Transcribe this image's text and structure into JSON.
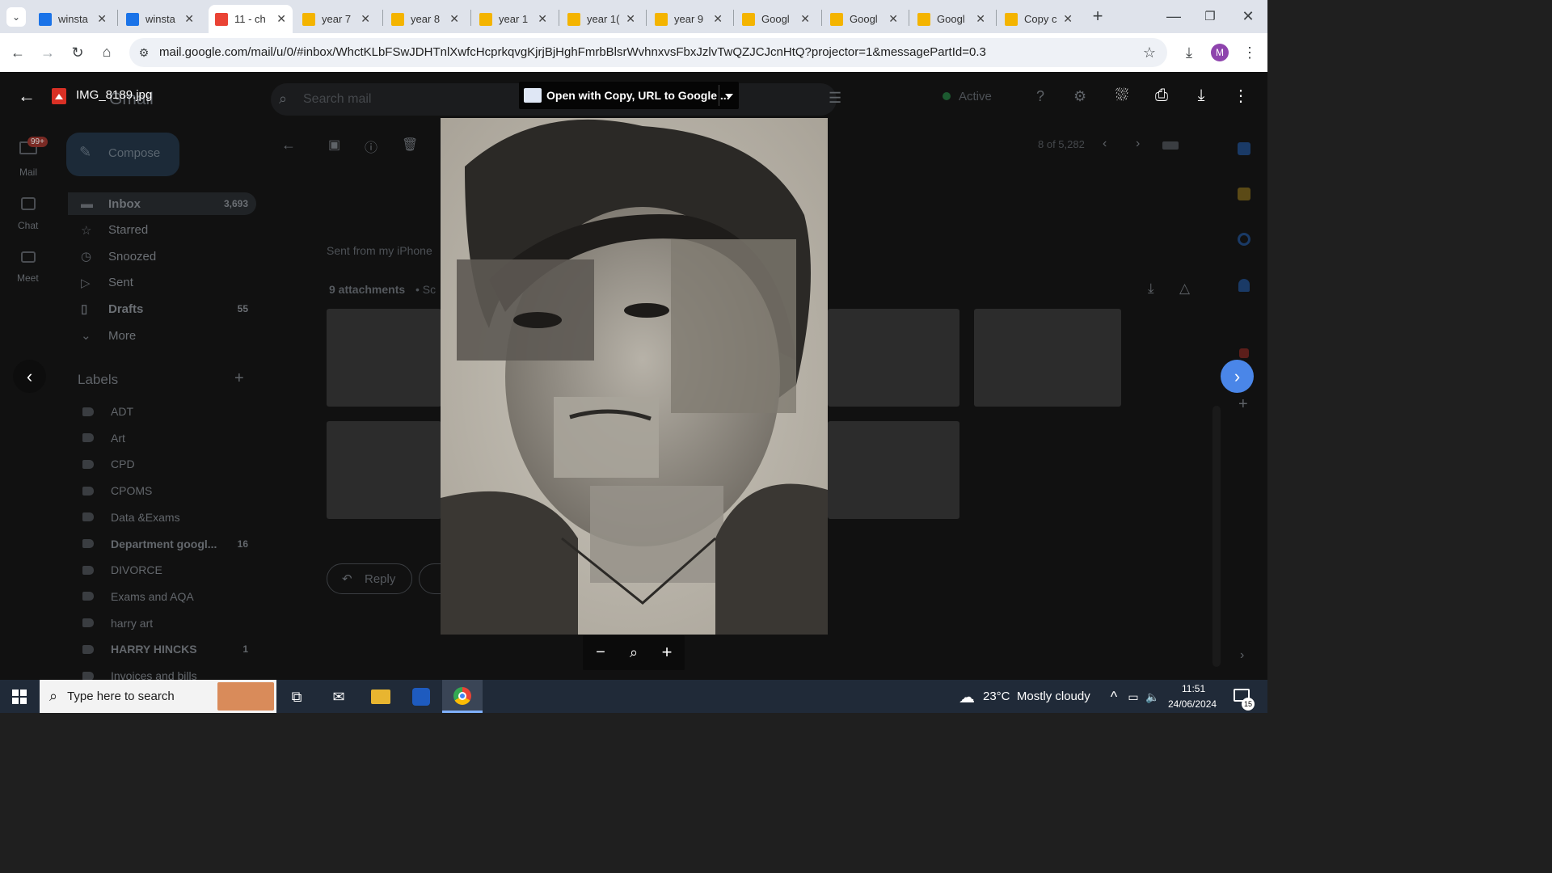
{
  "tabs": [
    {
      "label": "winsta",
      "favicon_color": "#1a73e8"
    },
    {
      "label": "winsta",
      "favicon_color": "#1a73e8"
    },
    {
      "label": "11 - ch",
      "favicon_color": "#ea4335",
      "active": true
    },
    {
      "label": "year 7",
      "favicon_color": "#f4b400"
    },
    {
      "label": "year 8",
      "favicon_color": "#f4b400"
    },
    {
      "label": "year 1",
      "favicon_color": "#f4b400"
    },
    {
      "label": "year 1(",
      "favicon_color": "#f4b400"
    },
    {
      "label": "year 9",
      "favicon_color": "#f4b400"
    },
    {
      "label": "Googl",
      "favicon_color": "#f4b400"
    },
    {
      "label": "Googl",
      "favicon_color": "#f4b400"
    },
    {
      "label": "Googl",
      "favicon_color": "#f4b400"
    },
    {
      "label": "Copy c",
      "favicon_color": "#f4b400"
    }
  ],
  "toolbar": {
    "url": "mail.google.com/mail/u/0/#inbox/WhctKLbFSwJDHTnlXwfcHcprkqvgKjrjBjHghFmrbBlsrWvhnxvsFbxJzlvTwQZJCJcnHtQ?projector=1&messagePartId=0.3",
    "profile_initial": "M"
  },
  "viewer": {
    "filename": "IMG_8189.jpg",
    "open_with_label": "Open with Copy, URL to Google ..."
  },
  "gmail": {
    "logo": "Gmail",
    "search_placeholder": "Search mail",
    "status": "Active",
    "compose_label": "Compose",
    "rail": [
      {
        "label": "Mail",
        "badge": "99+"
      },
      {
        "label": "Chat"
      },
      {
        "label": "Meet"
      }
    ],
    "nav": [
      {
        "label": "Inbox",
        "count": "3,693",
        "bold": true
      },
      {
        "label": "Starred",
        "count": ""
      },
      {
        "label": "Snoozed",
        "count": ""
      },
      {
        "label": "Sent",
        "count": ""
      },
      {
        "label": "Drafts",
        "count": "55",
        "bold": true
      },
      {
        "label": "More",
        "count": ""
      }
    ],
    "labels_header": "Labels",
    "labels": [
      {
        "label": "ADT",
        "count": ""
      },
      {
        "label": "Art",
        "count": ""
      },
      {
        "label": "CPD",
        "count": ""
      },
      {
        "label": "CPOMS",
        "count": ""
      },
      {
        "label": "Data &Exams",
        "count": ""
      },
      {
        "label": "Department googl...",
        "count": "16",
        "bold": true
      },
      {
        "label": "DIVORCE",
        "count": ""
      },
      {
        "label": "Exams and AQA",
        "count": ""
      },
      {
        "label": "harry art",
        "count": ""
      },
      {
        "label": "HARRY HINCKS",
        "count": "1",
        "bold": true
      },
      {
        "label": "Invoices and bills",
        "count": ""
      }
    ],
    "pagination": "8 of 5,282",
    "body_text": "Sent from my iPhone",
    "attachments_label": "9 attachments",
    "attachments_suffix": "• Sc",
    "reply_label": "Reply"
  },
  "taskbar": {
    "search_placeholder": "Type here to search",
    "weather": "23°C  Mostly cloudy",
    "time": "11:51",
    "date": "24/06/2024",
    "notifications": "15"
  }
}
